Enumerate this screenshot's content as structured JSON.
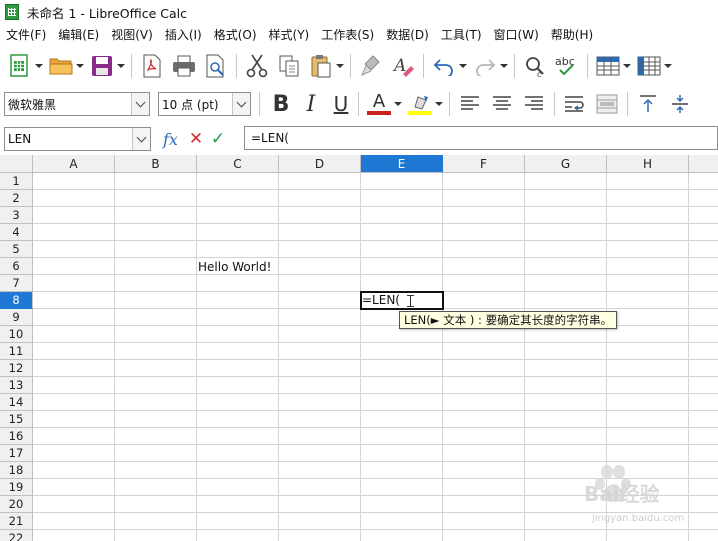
{
  "window": {
    "title": "未命名 1 - LibreOffice Calc"
  },
  "menu": [
    "文件(F)",
    "编辑(E)",
    "视图(V)",
    "插入(I)",
    "格式(O)",
    "样式(Y)",
    "工作表(S)",
    "数据(D)",
    "工具(T)",
    "窗口(W)",
    "帮助(H)"
  ],
  "toolbar": {
    "font_name": "微软雅黑",
    "font_size": "10 点 (pt)",
    "bold_glyph": "B",
    "italic_glyph": "I",
    "underline_glyph": "U",
    "font_color_glyph": "A",
    "font_color": "#c9211e",
    "highlight_color": "#ffff00"
  },
  "formula_bar": {
    "name_box": "LEN",
    "fx_label": "fx",
    "cancel_glyph": "✕",
    "accept_glyph": "✓",
    "content": "=LEN("
  },
  "sheet": {
    "columns": [
      "A",
      "B",
      "C",
      "D",
      "E",
      "F",
      "G",
      "H"
    ],
    "active_column": "E",
    "rows": [
      "1",
      "2",
      "3",
      "4",
      "5",
      "6",
      "7",
      "8",
      "9",
      "10",
      "11",
      "12",
      "13",
      "14",
      "15",
      "16",
      "17",
      "18",
      "19",
      "20",
      "21",
      "22"
    ],
    "active_row": "8",
    "cells": {
      "C6": "Hello World!",
      "E8": "=LEN("
    },
    "tooltip": "LEN(► 文本 ) : 要确定其长度的字符串。"
  },
  "watermark": {
    "text": "Bai经验",
    "url": "jingyan.baidu.com"
  },
  "colors": {
    "accent": "#1e78d4"
  }
}
